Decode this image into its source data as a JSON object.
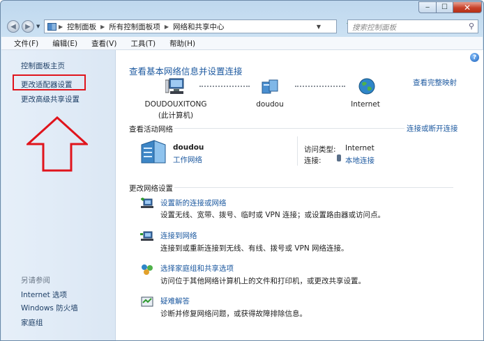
{
  "window": {
    "min": "‒",
    "max": "☐",
    "close": "✕"
  },
  "address": {
    "segments": [
      "控制面板",
      "所有控制面板项",
      "网络和共享中心"
    ]
  },
  "search": {
    "placeholder": "搜索控制面板"
  },
  "menu": [
    "文件(F)",
    "编辑(E)",
    "查看(V)",
    "工具(T)",
    "帮助(H)"
  ],
  "sidebar": {
    "links": [
      "控制面板主页",
      "更改适配器设置",
      "更改高级共享设置"
    ],
    "see_also_title": "另请参阅",
    "see_also": [
      "Internet 选项",
      "Windows 防火墙",
      "家庭组"
    ]
  },
  "main": {
    "title": "查看基本网络信息并设置连接",
    "full_map": "查看完整映射",
    "map": {
      "computer_name": "DOUDOUXITONG",
      "computer_sub": "(此计算机)",
      "network": "doudou",
      "internet": "Internet"
    },
    "active_header": "查看活动网络",
    "connect_link": "连接或断开连接",
    "active": {
      "name": "doudou",
      "type_link": "工作网络",
      "access_label": "访问类型:",
      "access_value": "Internet",
      "conn_label": "连接:",
      "conn_value": "本地连接"
    },
    "change_header": "更改网络设置",
    "tasks": [
      {
        "name": "设置新的连接或网络",
        "desc": "设置无线、宽带、拨号、临时或 VPN 连接；或设置路由器或访问点。"
      },
      {
        "name": "连接到网络",
        "desc": "连接到或重新连接到无线、有线、拨号或 VPN 网络连接。"
      },
      {
        "name": "选择家庭组和共享选项",
        "desc": "访问位于其他网络计算机上的文件和打印机，或更改共享设置。"
      },
      {
        "name": "疑难解答",
        "desc": "诊断并修复网络问题，或获得故障排除信息。"
      }
    ]
  },
  "colors": {
    "accent": "#1e5aa0",
    "highlight_box": "#e0141c"
  }
}
